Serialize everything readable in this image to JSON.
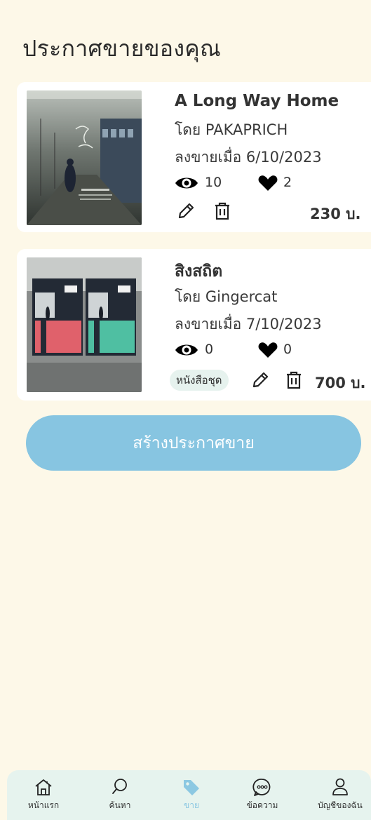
{
  "page": {
    "title": "ประกาศขายของคุณ"
  },
  "listings": [
    {
      "title": "A Long Way Home",
      "author": "โดย PAKAPRICH",
      "listed": "ลงขายเมื่อ 6/10/2023",
      "views": "10",
      "likes": "2",
      "price": "230 บ.",
      "badge": ""
    },
    {
      "title": "สิงสถิต",
      "author": "โดย  Gingercat",
      "listed": "ลงขายเมื่อ 7/10/2023",
      "views": "0",
      "likes": "0",
      "price": "700 บ.",
      "badge": "หนังสือชุด"
    }
  ],
  "create_button": {
    "label": "สร้างประกาศขาย"
  },
  "nav": {
    "items": [
      {
        "label": "หน้าแรก",
        "icon": "home-icon"
      },
      {
        "label": "ค้นหา",
        "icon": "search-icon"
      },
      {
        "label": "ขาย",
        "icon": "tag-icon",
        "active": true
      },
      {
        "label": "ข้อความ",
        "icon": "chat-icon"
      },
      {
        "label": "บัญชีของฉัน",
        "icon": "user-icon"
      }
    ]
  },
  "colors": {
    "background": "#fdf8e8",
    "accent": "#87c5e1",
    "nav_background": "#e6f3ee",
    "active_tab": "#8cc8e2"
  }
}
